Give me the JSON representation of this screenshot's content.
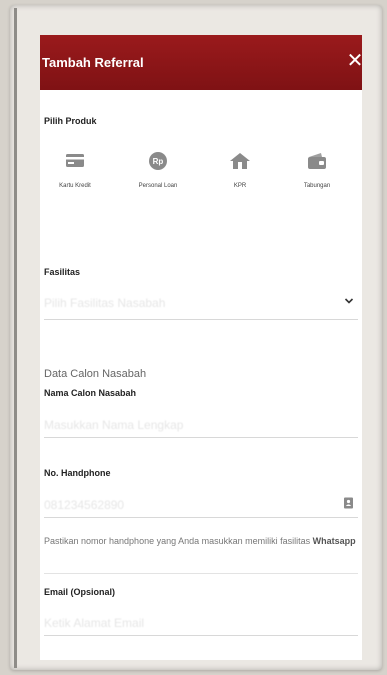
{
  "header": {
    "title": "Tambah Referral",
    "close_label": "✕"
  },
  "pilih_produk": {
    "label": "Pilih Produk",
    "items": [
      {
        "label": "Kartu Kredit",
        "icon": "credit-card-icon"
      },
      {
        "label": "Personal Loan",
        "icon": "rp-coin-icon"
      },
      {
        "label": "KPR",
        "icon": "house-icon"
      },
      {
        "label": "Tabungan",
        "icon": "wallet-icon"
      }
    ]
  },
  "fasilitas": {
    "label": "Fasilitas",
    "placeholder": "Pilih Fasilitas Nasabah"
  },
  "data_calon": {
    "section_title": "Data Calon Nasabah",
    "nama_label": "Nama Calon Nasabah",
    "nama_placeholder": "Masukkan Nama Lengkap"
  },
  "handphone": {
    "label": "No. Handphone",
    "placeholder": "081234562890",
    "note_prefix": "Pastikan nomor handphone yang Anda masukkan memiliki fasilitas",
    "note_bold": "Whatsapp"
  },
  "email": {
    "label": "Email (Opsional)",
    "placeholder": "Ketik Alamat Email"
  },
  "colors": {
    "header_bg": "#8b1517",
    "accent": "#9a1a1c",
    "icon_gray": "#8a8a8a"
  }
}
